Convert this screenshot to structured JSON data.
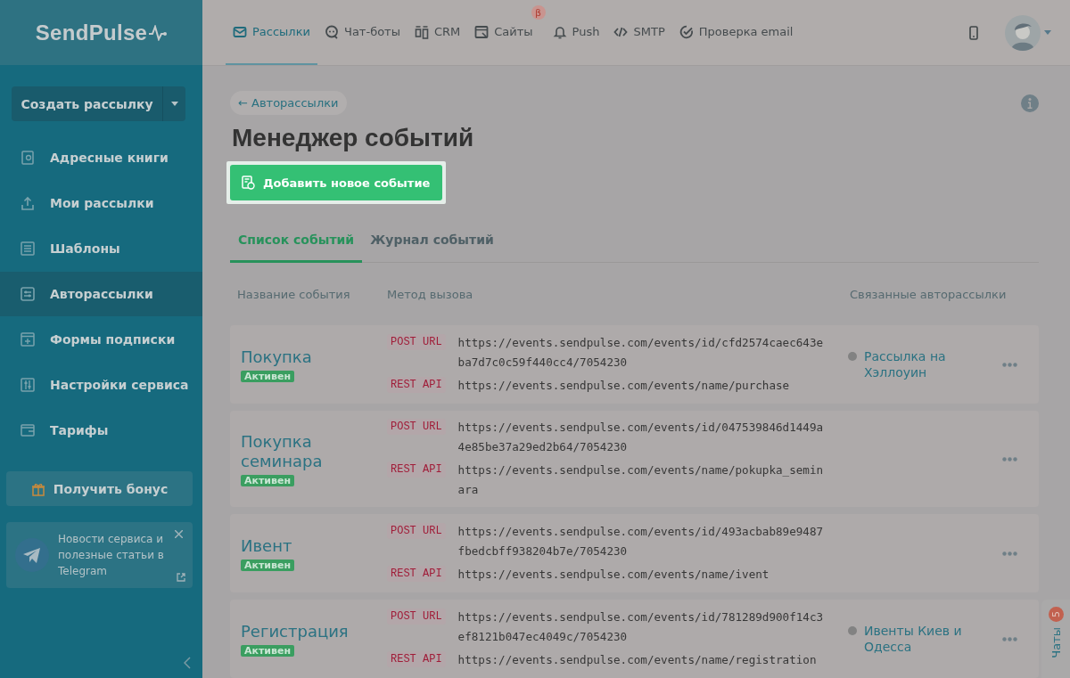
{
  "logo": "SendPulse",
  "create_button": "Создать рассылку",
  "sidebar": {
    "items": [
      {
        "label": "Адресные книги",
        "selected": false
      },
      {
        "label": "Мои рассылки",
        "selected": false
      },
      {
        "label": "Шаблоны",
        "selected": false
      },
      {
        "label": "Авторассылки",
        "selected": true
      },
      {
        "label": "Формы подписки",
        "selected": false
      },
      {
        "label": "Настройки сервиса",
        "selected": false
      },
      {
        "label": "Тарифы",
        "selected": false
      }
    ],
    "bonus_button": "Получить бонус",
    "telegram_card": {
      "text": "Новости сервиса и полезные статьи в Telegram"
    }
  },
  "top_nav": [
    {
      "label": "Рассылки",
      "selected": true
    },
    {
      "label": "Чат-боты",
      "selected": false
    },
    {
      "label": "CRM",
      "selected": false
    },
    {
      "label": "Сайты",
      "selected": false,
      "badge": "β"
    },
    {
      "label": "Push",
      "selected": false
    },
    {
      "label": "SMTP",
      "selected": false
    },
    {
      "label": "Проверка email",
      "selected": false
    }
  ],
  "breadcrumb": "← Авторассылки",
  "title": "Менеджер событий",
  "add_button": "Добавить новое событие",
  "tabs": [
    {
      "label": "Список событий",
      "selected": true
    },
    {
      "label": "Журнал событий",
      "selected": false
    }
  ],
  "table": {
    "columns": [
      "Название события",
      "Метод вызова",
      "Связанные авторассылки"
    ],
    "rows": [
      {
        "name": "Покупка",
        "status": "Активен",
        "methods": [
          {
            "label": "POST URL",
            "url": "https://events.sendpulse.com/events/id/cfd2574caec643eba7d7c0c59f440cc4/7054230"
          },
          {
            "label": "REST API",
            "url": "https://events.sendpulse.com/events/name/purchase"
          }
        ],
        "linked": [
          "Рассылка на Хэллоуин"
        ]
      },
      {
        "name": "Покупка семинара",
        "status": "Активен",
        "methods": [
          {
            "label": "POST URL",
            "url": "https://events.sendpulse.com/events/id/047539846d1449a4e85be37a29ed2b64/7054230"
          },
          {
            "label": "REST API",
            "url": "https://events.sendpulse.com/events/name/pokupka_seminara"
          }
        ],
        "linked": []
      },
      {
        "name": "Ивент",
        "status": "Активен",
        "methods": [
          {
            "label": "POST URL",
            "url": "https://events.sendpulse.com/events/id/493acbab89e9487fbedcbff938204b7e/7054230"
          },
          {
            "label": "REST API",
            "url": "https://events.sendpulse.com/events/name/ivent"
          }
        ],
        "linked": []
      },
      {
        "name": "Регистрация",
        "status": "Активен",
        "methods": [
          {
            "label": "POST URL",
            "url": "https://events.sendpulse.com/events/id/781289d900f14c3ef8121b047ec4049c/7054230"
          },
          {
            "label": "REST API",
            "url": "https://events.sendpulse.com/events/name/registration"
          }
        ],
        "linked": [
          "Ивенты Киев и Одесса"
        ]
      }
    ]
  },
  "chats_tab": {
    "label": "Чаты",
    "badge": "5"
  }
}
